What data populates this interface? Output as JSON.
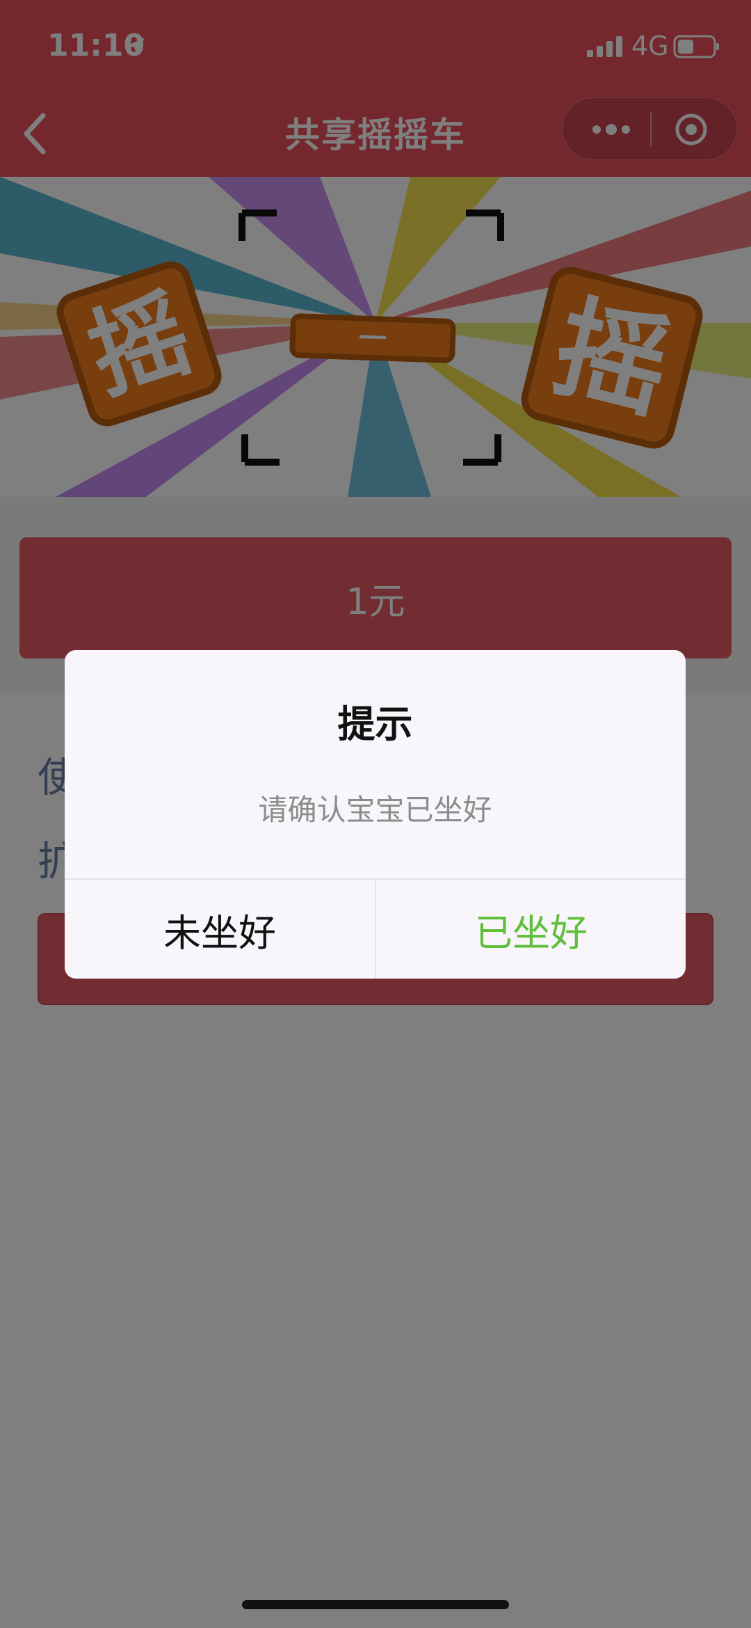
{
  "status_bar": {
    "time": "11:10",
    "network": "4G",
    "icons": [
      "location-arrow-icon",
      "signal-icon",
      "battery-icon"
    ]
  },
  "nav": {
    "title": "共享摇摇车",
    "icons": [
      "back-arrow-icon",
      "more-dots-icon",
      "target-circle-icon"
    ]
  },
  "banner": {
    "text_left": "摇",
    "text_middle": "一",
    "text_right": "摇"
  },
  "pay": {
    "price_label": "1元"
  },
  "info": {
    "line1": "使",
    "line2": "扩"
  },
  "modal": {
    "title": "提示",
    "content": "请确认宝宝已坐好",
    "cancel_label": "未坐好",
    "confirm_label": "已坐好"
  },
  "colors": {
    "brand": "#e8505b",
    "confirm_text": "#5fbf3b",
    "cancel_text": "#111111",
    "hint_text": "#8c8c8c"
  }
}
